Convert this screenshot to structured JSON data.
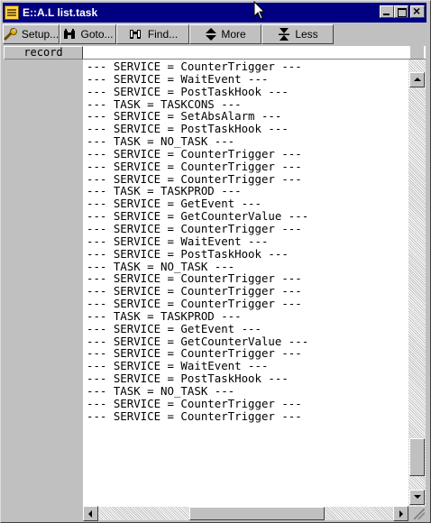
{
  "window": {
    "title": "E::A.L list.task"
  },
  "toolbar": {
    "buttons": [
      {
        "label": "Setup...",
        "icon": "wrench-icon"
      },
      {
        "label": "Goto...",
        "icon": "binoculars-icon"
      },
      {
        "label": "Find...",
        "icon": "find-icon"
      },
      {
        "label": "More",
        "icon": "up-down-arrows-icon"
      },
      {
        "label": "Less",
        "icon": "collapse-arrows-icon"
      }
    ]
  },
  "columns": {
    "record_label": "record"
  },
  "listing": {
    "lines": [
      "--- SERVICE = CounterTrigger ---",
      "--- SERVICE = WaitEvent ---",
      "--- SERVICE = PostTaskHook ---",
      "--- TASK = TASKCONS ---",
      "--- SERVICE = SetAbsAlarm ---",
      "--- SERVICE = PostTaskHook ---",
      "--- TASK = NO_TASK ---",
      "--- SERVICE = CounterTrigger ---",
      "--- SERVICE = CounterTrigger ---",
      "--- SERVICE = CounterTrigger ---",
      "--- TASK = TASKPROD ---",
      "--- SERVICE = GetEvent ---",
      "--- SERVICE = GetCounterValue ---",
      "--- SERVICE = CounterTrigger ---",
      "--- SERVICE = WaitEvent ---",
      "--- SERVICE = PostTaskHook ---",
      "--- TASK = NO_TASK ---",
      "--- SERVICE = CounterTrigger ---",
      "--- SERVICE = CounterTrigger ---",
      "--- SERVICE = CounterTrigger ---",
      "--- TASK = TASKPROD ---",
      "--- SERVICE = GetEvent ---",
      "--- SERVICE = GetCounterValue ---",
      "--- SERVICE = CounterTrigger ---",
      "--- SERVICE = WaitEvent ---",
      "--- SERVICE = PostTaskHook ---",
      "--- TASK = NO_TASK ---",
      "--- SERVICE = CounterTrigger ---",
      "--- SERVICE = CounterTrigger ---"
    ]
  },
  "scroll": {
    "vertical_position_fraction": 0.93
  },
  "colors": {
    "title_bar": "#000080",
    "chrome": "#c0c0c0",
    "text": "#000000"
  }
}
